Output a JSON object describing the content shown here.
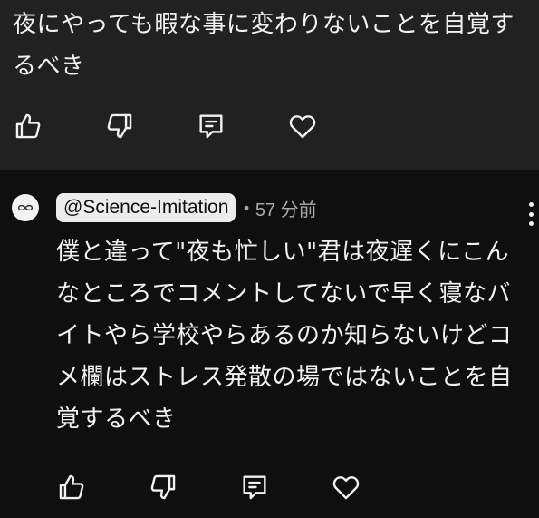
{
  "comment_prev": {
    "text": "夜にやっても暇な事に変わりないことを自覚するべき"
  },
  "comment": {
    "author_handle": "@Science-Imitation",
    "separator": "•",
    "time": "57 分前",
    "text": "僕と違って\"夜も忙しい\"君は夜遅くにこんなところでコメントしてないで早く寝なバイトやら学校やらあるのか知らないけどコメ欄はストレス発散の場ではないことを自覚するべき"
  },
  "icons": {
    "like": "thumbs-up-icon",
    "dislike": "thumbs-down-icon",
    "reply": "comment-icon",
    "heart": "heart-icon",
    "more": "more-vertical-icon",
    "avatar": "infinity-icon"
  },
  "colors": {
    "background": "#0f0f0f",
    "highlight_background": "#212121",
    "text": "#f1f1f1",
    "secondary_text": "#aaaaaa",
    "handle_chip": "#ececec"
  }
}
